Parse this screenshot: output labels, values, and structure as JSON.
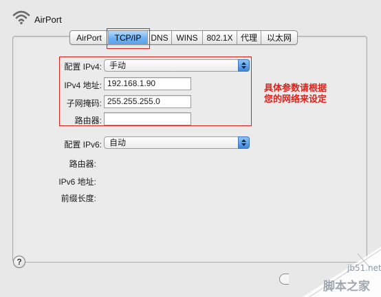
{
  "window": {
    "title": "AirPort"
  },
  "tabs": [
    {
      "label": "AirPort",
      "active": false
    },
    {
      "label": "TCP/IP",
      "active": true
    },
    {
      "label": "DNS",
      "active": false
    },
    {
      "label": "WINS",
      "active": false
    },
    {
      "label": "802.1X",
      "active": false
    },
    {
      "label": "代理",
      "active": false
    },
    {
      "label": "以太网",
      "active": false
    }
  ],
  "ipv4": {
    "config_label": "配置 IPv4:",
    "config_value": "手动",
    "address_label": "IPv4 地址:",
    "address_value": "192.168.1.90",
    "subnet_label": "子网掩码:",
    "subnet_value": "255.255.255.0",
    "router_label": "路由器:",
    "router_value": ""
  },
  "ipv6": {
    "config_label": "配置 IPv6:",
    "config_value": "自动",
    "router_label": "路由器:",
    "address_label": "IPv6 地址:",
    "prefix_label": "前缀长度:"
  },
  "annotation": {
    "line1": "具体参数请根据",
    "line2": "您的网络来设定"
  },
  "help": {
    "label": "?"
  },
  "watermark": {
    "small": "jb51.net",
    "big": "脚本之家"
  },
  "colors": {
    "highlight_red": "#e0201a",
    "tab_active_blue": "#6fb2f2",
    "panel_bg": "#ebebeb"
  }
}
